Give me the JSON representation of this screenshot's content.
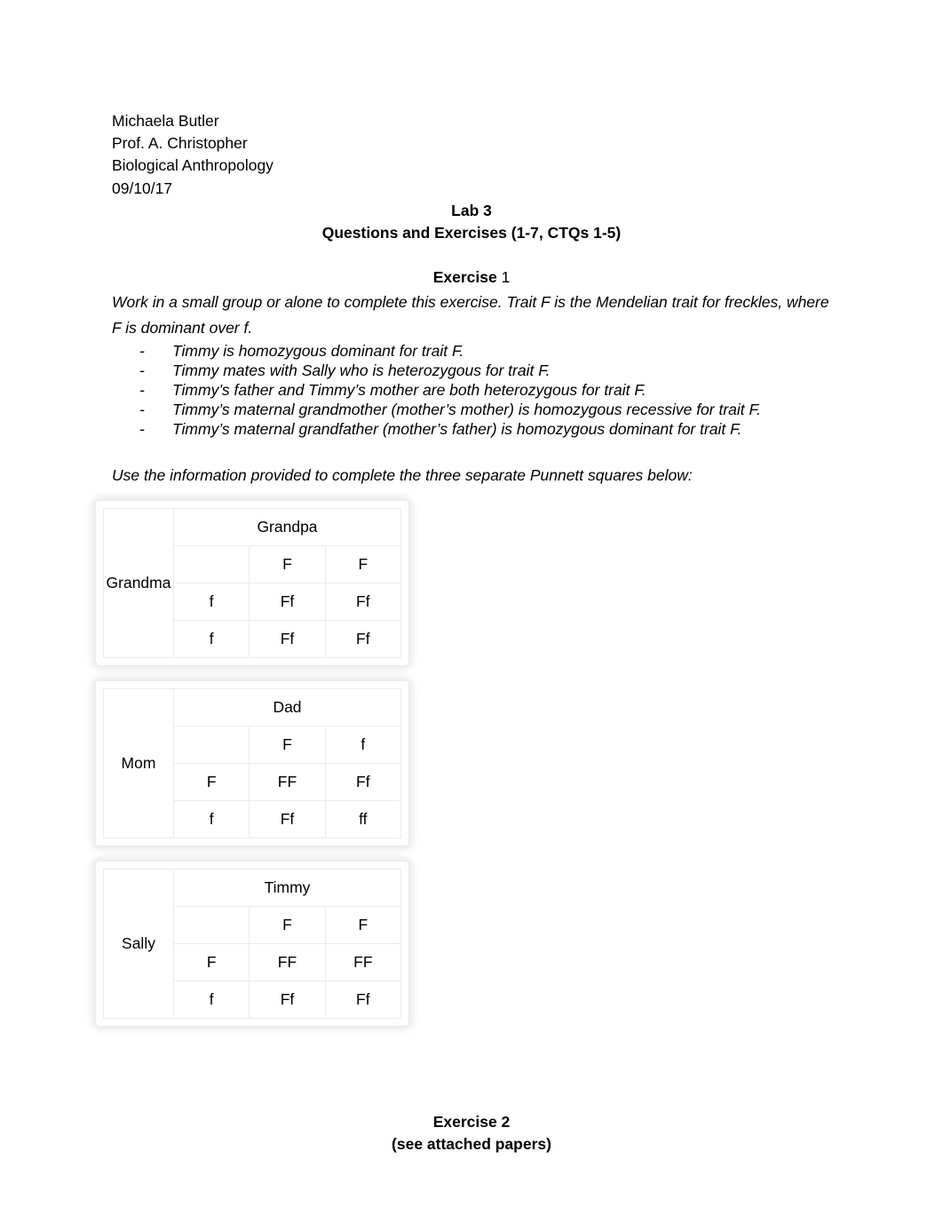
{
  "header": {
    "student_name": "Michaela Butler",
    "professor": "Prof. A. Christopher",
    "course": "Biological Anthropology",
    "date": "09/10/17"
  },
  "title": {
    "line1": "Lab 3",
    "line2": "Questions and Exercises (1-7, CTQs 1-5)"
  },
  "exercise1": {
    "heading_bold": "Exercise",
    "heading_number": "1",
    "intro": "Work in a small group or alone to complete this exercise. Trait F is the Mendelian trait for freckles, where F is dominant over f.",
    "bullet_marker": "-",
    "bullets": [
      "Timmy is homozygous dominant for trait F.",
      "Timmy mates with Sally who is heterozygous for trait F.",
      "Timmy’s father and Timmy’s mother are both heterozygous for trait F.",
      "Timmy’s maternal grandmother (mother’s mother) is homozygous recessive for trait F.",
      "Timmy’s maternal grandfather (mother’s father) is homozygous dominant for trait F."
    ],
    "instruction": "Use the information provided to complete the three separate Punnett squares below:"
  },
  "punnett_squares": [
    {
      "id": "grandparents",
      "row_parent_label": "Grandma",
      "col_parent_label": "Grandpa",
      "col_alleles": [
        "F",
        "F"
      ],
      "row_alleles": [
        "f",
        "f"
      ],
      "offspring": [
        [
          "Ff",
          "Ff"
        ],
        [
          "Ff",
          "Ff"
        ]
      ]
    },
    {
      "id": "parents",
      "row_parent_label": "Mom",
      "col_parent_label": "Dad",
      "col_alleles": [
        "F",
        "f"
      ],
      "row_alleles": [
        "F",
        "f"
      ],
      "offspring": [
        [
          "FF",
          "Ff"
        ],
        [
          "Ff",
          "ff"
        ]
      ]
    },
    {
      "id": "sally-timmy",
      "row_parent_label": "Sally",
      "col_parent_label": "Timmy",
      "col_alleles": [
        "F",
        "F"
      ],
      "row_alleles": [
        "F",
        "f"
      ],
      "offspring": [
        [
          "FF",
          "FF"
        ],
        [
          "Ff",
          "Ff"
        ]
      ]
    }
  ],
  "exercise2": {
    "title": "Exercise 2",
    "note": "(see attached papers)"
  }
}
